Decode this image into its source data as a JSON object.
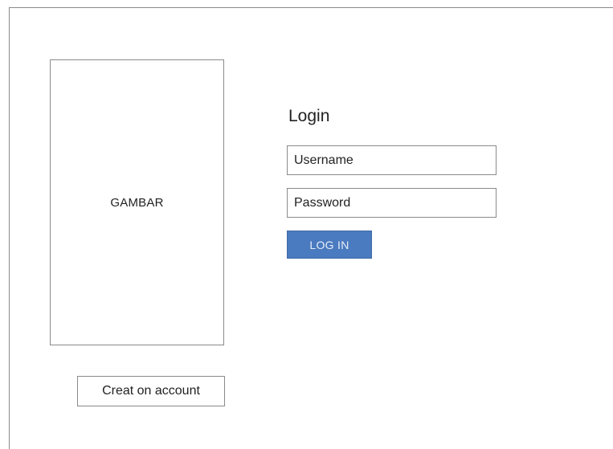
{
  "image_placeholder": {
    "label": "GAMBAR"
  },
  "login": {
    "title": "Login",
    "username_placeholder": "Username",
    "password_placeholder": "Password",
    "submit_label": "LOG IN"
  },
  "create_account": {
    "label": "Creat on account"
  },
  "colors": {
    "login_button_background": "#4a7abf",
    "border": "#8a8a8a",
    "background": "#ffffff"
  }
}
